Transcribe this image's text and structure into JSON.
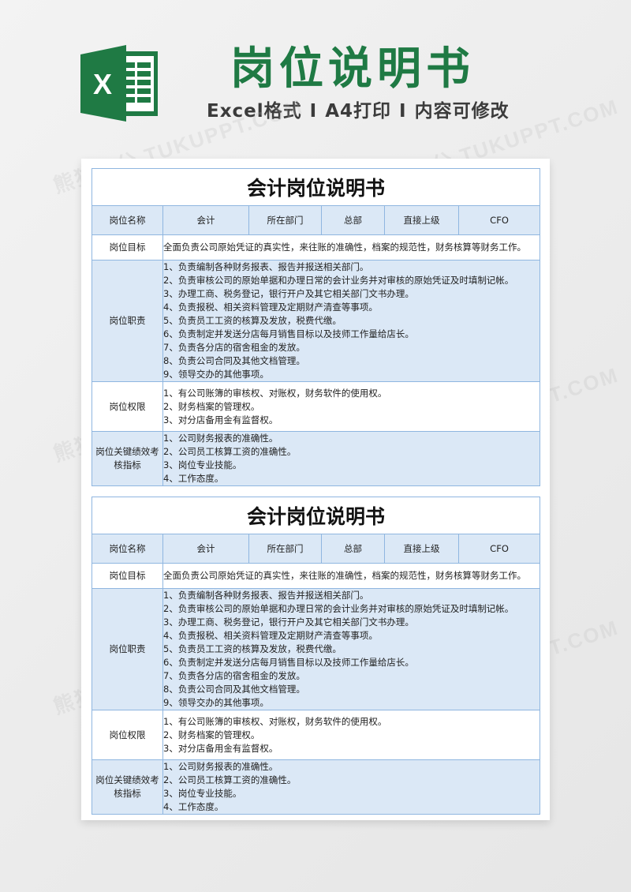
{
  "header": {
    "logo_icon": "excel-icon",
    "title": "岗位说明书",
    "subtitle_parts": [
      "Excel格式",
      "I",
      "A4打印",
      "I",
      "内容可修改"
    ]
  },
  "watermark": "熊猫办公 TUKUPPT.COM",
  "colors": {
    "brand_green": "#1f7a44",
    "cell_blue": "#dbe8f6",
    "border_blue": "#8fb6e0"
  },
  "sheets": [
    {
      "title": "会计岗位说明书",
      "header_row": {
        "position_name_label": "岗位名称",
        "position_name": "会计",
        "department_label": "所在部门",
        "department": "总部",
        "supervisor_label": "直接上级",
        "supervisor": "CFO"
      },
      "goal": {
        "label": "岗位目标",
        "text": "全面负责公司原始凭证的真实性，来往账的准确性，档案的规范性，财务核算等财务工作。"
      },
      "duties": {
        "label": "岗位职责",
        "items": [
          "1、负责编制各种财务报表、报告并报送相关部门。",
          "2、负责审核公司的原始单据和办理日常的会计业务并对审核的原始凭证及时填制记帐。",
          "3、办理工商、税务登记，银行开户及其它相关部门文书办理。",
          "4、负责报税、相关资料管理及定期财产清查等事项。",
          "5、负责员工工资的核算及发放，税费代缴。",
          "6、负责制定并发送分店每月销售目标以及技师工作量给店长。",
          "7、负责各分店的宿舍租金的发放。",
          "8、负责公司合同及其他文档管理。",
          "9、领导交办的其他事项。"
        ]
      },
      "authority": {
        "label": "岗位权限",
        "items": [
          "1、有公司账簿的审核权、对账权，财务软件的使用权。",
          "2、财务档案的管理权。",
          "3、对分店备用金有监督权。"
        ]
      },
      "kpi": {
        "label_line1": "岗位关键绩效考",
        "label_line2": "核指标",
        "items": [
          "1、公司财务报表的准确性。",
          "2、公司员工核算工资的准确性。",
          "3、岗位专业技能。",
          "4、工作态度。"
        ]
      }
    },
    {
      "title": "会计岗位说明书",
      "header_row": {
        "position_name_label": "岗位名称",
        "position_name": "会计",
        "department_label": "所在部门",
        "department": "总部",
        "supervisor_label": "直接上级",
        "supervisor": "CFO"
      },
      "goal": {
        "label": "岗位目标",
        "text": "全面负责公司原始凭证的真实性，来往账的准确性，档案的规范性，财务核算等财务工作。"
      },
      "duties": {
        "label": "岗位职责",
        "items": [
          "1、负责编制各种财务报表、报告并报送相关部门。",
          "2、负责审核公司的原始单据和办理日常的会计业务并对审核的原始凭证及时填制记帐。",
          "3、办理工商、税务登记，银行开户及其它相关部门文书办理。",
          "4、负责报税、相关资料管理及定期财产清查等事项。",
          "5、负责员工工资的核算及发放，税费代缴。",
          "6、负责制定并发送分店每月销售目标以及技师工作量给店长。",
          "7、负责各分店的宿舍租金的发放。",
          "8、负责公司合同及其他文档管理。",
          "9、领导交办的其他事项。"
        ]
      },
      "authority": {
        "label": "岗位权限",
        "items": [
          "1、有公司账簿的审核权、对账权，财务软件的使用权。",
          "2、财务档案的管理权。",
          "3、对分店备用金有监督权。"
        ]
      },
      "kpi": {
        "label_line1": "岗位关键绩效考",
        "label_line2": "核指标",
        "items": [
          "1、公司财务报表的准确性。",
          "2、公司员工核算工资的准确性。",
          "3、岗位专业技能。",
          "4、工作态度。"
        ]
      }
    }
  ]
}
